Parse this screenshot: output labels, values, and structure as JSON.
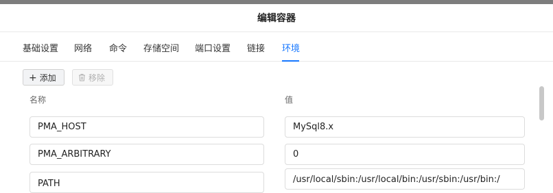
{
  "dialog": {
    "title": "编辑容器"
  },
  "tabs": [
    {
      "label": "基础设置"
    },
    {
      "label": "网络"
    },
    {
      "label": "命令"
    },
    {
      "label": "存储空间"
    },
    {
      "label": "端口设置"
    },
    {
      "label": "链接"
    },
    {
      "label": "环境",
      "active": true
    }
  ],
  "toolbar": {
    "add_label": "添加",
    "add_icon": "plus-icon",
    "remove_label": "移除",
    "remove_icon": "trash-icon"
  },
  "columns": {
    "name": "名称",
    "value": "值"
  },
  "env": [
    {
      "name": "PMA_HOST",
      "value": "MySql8.x"
    },
    {
      "name": "PMA_ARBITRARY",
      "value": "0"
    },
    {
      "name": "PATH",
      "value": "/usr/local/sbin:/usr/local/bin:/usr/sbin:/usr/bin:/"
    }
  ],
  "colors": {
    "accent": "#1677ff"
  }
}
